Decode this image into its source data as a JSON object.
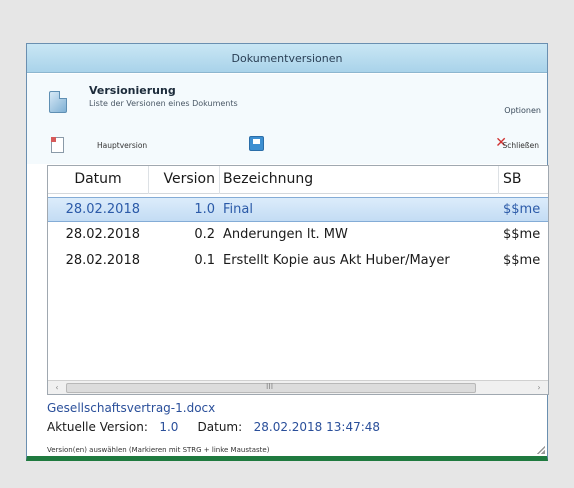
{
  "window": {
    "title": "Dokumentversionen"
  },
  "header": {
    "title": "Versionierung",
    "subtitle": "Liste der Versionen eines Dokuments",
    "options_label": "Optionen"
  },
  "toolbar": {
    "hauptversion_label": "Hauptversion",
    "close_label": "Schließen",
    "close_glyph": "✕"
  },
  "table": {
    "columns": [
      "Datum",
      "Version",
      "Bezeichnung",
      "SB"
    ],
    "rows": [
      {
        "datum": "28.02.2018",
        "version": "1.0",
        "bezeichnung": "Final",
        "sb": "$$me"
      },
      {
        "datum": "28.02.2018",
        "version": "0.2",
        "bezeichnung": "Änderungen lt. MW",
        "sb": "$$me"
      },
      {
        "datum": "28.02.2018",
        "version": "0.1",
        "bezeichnung": "Erstellt Kopie aus Akt Huber/Mayer",
        "sb": "$$me"
      }
    ],
    "selected_row": 0
  },
  "scrollbar": {
    "left_arrow": "‹",
    "right_arrow": "›",
    "grip": "III"
  },
  "footer": {
    "filename": "Gesellschaftsvertrag-1.docx",
    "current_version_label": "Aktuelle Version:",
    "current_version_value": "1.0",
    "date_label": "Datum:",
    "date_value": "28.02.2018 13:47:48",
    "hint": "Version(en) auswählen (Markieren mit STRG + linke Maustaste)"
  },
  "colors": {
    "accent_bottom": "#1f7a3f",
    "selected_row": "#c3dcf4",
    "close": "#d03030",
    "link_text": "#2a4f9a"
  }
}
